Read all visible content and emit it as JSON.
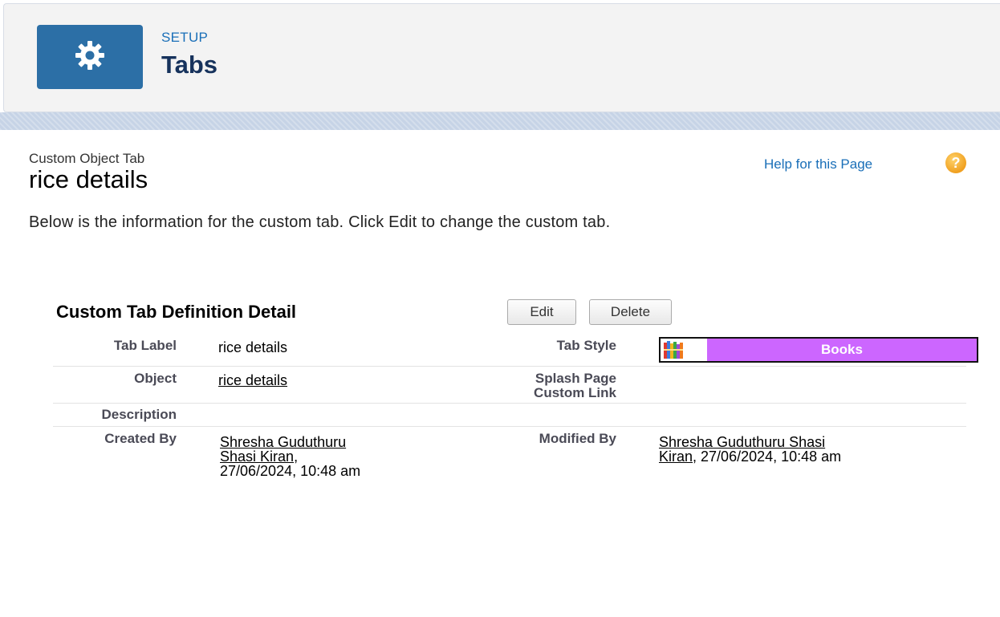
{
  "header": {
    "setup_label": "SETUP",
    "title": "Tabs",
    "icon": "gear-icon",
    "icon_bg": "#2c6fa6"
  },
  "page": {
    "object_type": "Custom Object Tab",
    "title": "rice details",
    "help_link": "Help for this Page",
    "help_icon": "help-icon",
    "description": "Below is the information for the custom tab. Click Edit to change the custom tab."
  },
  "detail": {
    "section_title": "Custom Tab Definition Detail",
    "edit_label": "Edit",
    "delete_label": "Delete",
    "tab_label_label": "Tab Label",
    "tab_label_value": "rice details",
    "tab_style_label": "Tab Style",
    "tab_style_name": "Books",
    "tab_style_icon": "books-icon",
    "tab_style_color": "#cc66ff",
    "object_label": "Object",
    "object_value": "rice details",
    "splash_label_1": "Splash Page",
    "splash_label_2": "Custom Link",
    "description_label": "Description",
    "created_by_label": "Created By",
    "created_by_name_1": "Shresha Guduthuru",
    "created_by_name_2": "Shasi Kiran",
    "created_by_suffix": ",",
    "created_by_date": "27/06/2024, 10:48 am",
    "modified_by_label": "Modified By",
    "modified_by_name_1": "Shresha Guduthuru Shasi",
    "modified_by_name_2": "Kiran",
    "modified_by_date": ", 27/06/2024, 10:48 am"
  }
}
